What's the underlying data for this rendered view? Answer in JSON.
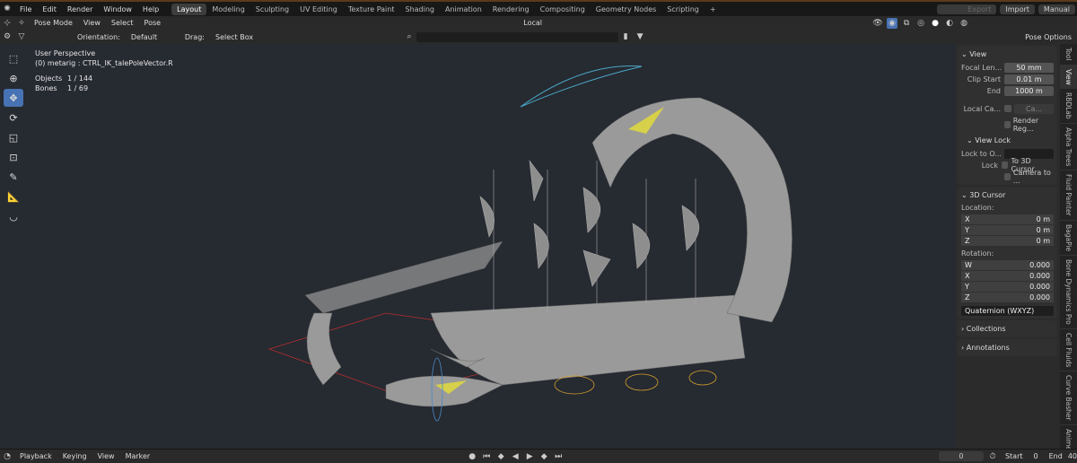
{
  "menu": [
    "File",
    "Edit",
    "Render",
    "Window",
    "Help"
  ],
  "workspaces": [
    "Layout",
    "Modeling",
    "Sculpting",
    "UV Editing",
    "Texture Paint",
    "Shading",
    "Animation",
    "Rendering",
    "Compositing",
    "Geometry Nodes",
    "Scripting",
    "+"
  ],
  "top_right": {
    "export": "Export",
    "import": "Import",
    "manual": "Manual"
  },
  "header": {
    "mode": "Pose Mode",
    "view": "View",
    "select": "Select",
    "pose": "Pose",
    "local": "Local"
  },
  "tool_header": {
    "orientation_label": "Orientation:",
    "orientation": "Default",
    "drag_label": "Drag:",
    "drag": "Select Box",
    "pose_options": "Pose Options"
  },
  "overlay": {
    "perspective": "User Perspective",
    "active": "(0) metarig : CTRL_IK_talePoleVector.R",
    "objects_label": "Objects",
    "objects": "1 / 144",
    "bones_label": "Bones",
    "bones": "1 / 69"
  },
  "tools": [
    "select-box",
    "cursor",
    "move",
    "rotate",
    "scale",
    "transform",
    "annotate",
    "measure",
    "bone-roll"
  ],
  "npanel": {
    "view_title": "View",
    "focal_label": "Focal Len...",
    "focal": "50 mm",
    "clip_start_label": "Clip Start",
    "clip_start": "0.01 m",
    "end_label": "End",
    "end": "1000 m",
    "local_cam_label": "Local Ca...",
    "local_cam": "Ca...",
    "render_region": "Render Reg...",
    "view_lock": "View Lock",
    "lock_to_label": "Lock to O...",
    "lock_label": "Lock",
    "to_cursor": "To 3D Cursor",
    "camera_to": "Camera to ...",
    "cursor_title": "3D Cursor",
    "location": "Location:",
    "loc": [
      {
        "a": "X",
        "v": "0 m"
      },
      {
        "a": "Y",
        "v": "0 m"
      },
      {
        "a": "Z",
        "v": "0 m"
      }
    ],
    "rotation": "Rotation:",
    "rot": [
      {
        "a": "W",
        "v": "0.000"
      },
      {
        "a": "X",
        "v": "0.000"
      },
      {
        "a": "Y",
        "v": "0.000"
      },
      {
        "a": "Z",
        "v": "0.000"
      }
    ],
    "rot_mode": "Quaternion (WXYZ)",
    "collections": "Collections",
    "annotations": "Annotations"
  },
  "side_tabs": [
    "Tool",
    "View",
    "RBDLab",
    "Alpha Trees",
    "Fluid Painter",
    "BagaPie",
    "Bone Dynamics Pro",
    "Cell Fluids",
    "Curve Basher",
    "Anime"
  ],
  "timeline": {
    "playback": "Playback",
    "keying": "Keying",
    "view": "View",
    "marker": "Marker",
    "frame": "0",
    "start_label": "Start",
    "start": "0",
    "end_label": "End",
    "end": "40"
  },
  "colors": {
    "accent": "#4772b3",
    "viewport": "#262a31",
    "bone_yellow": "#d6d04a",
    "rig_red": "#b03030"
  }
}
